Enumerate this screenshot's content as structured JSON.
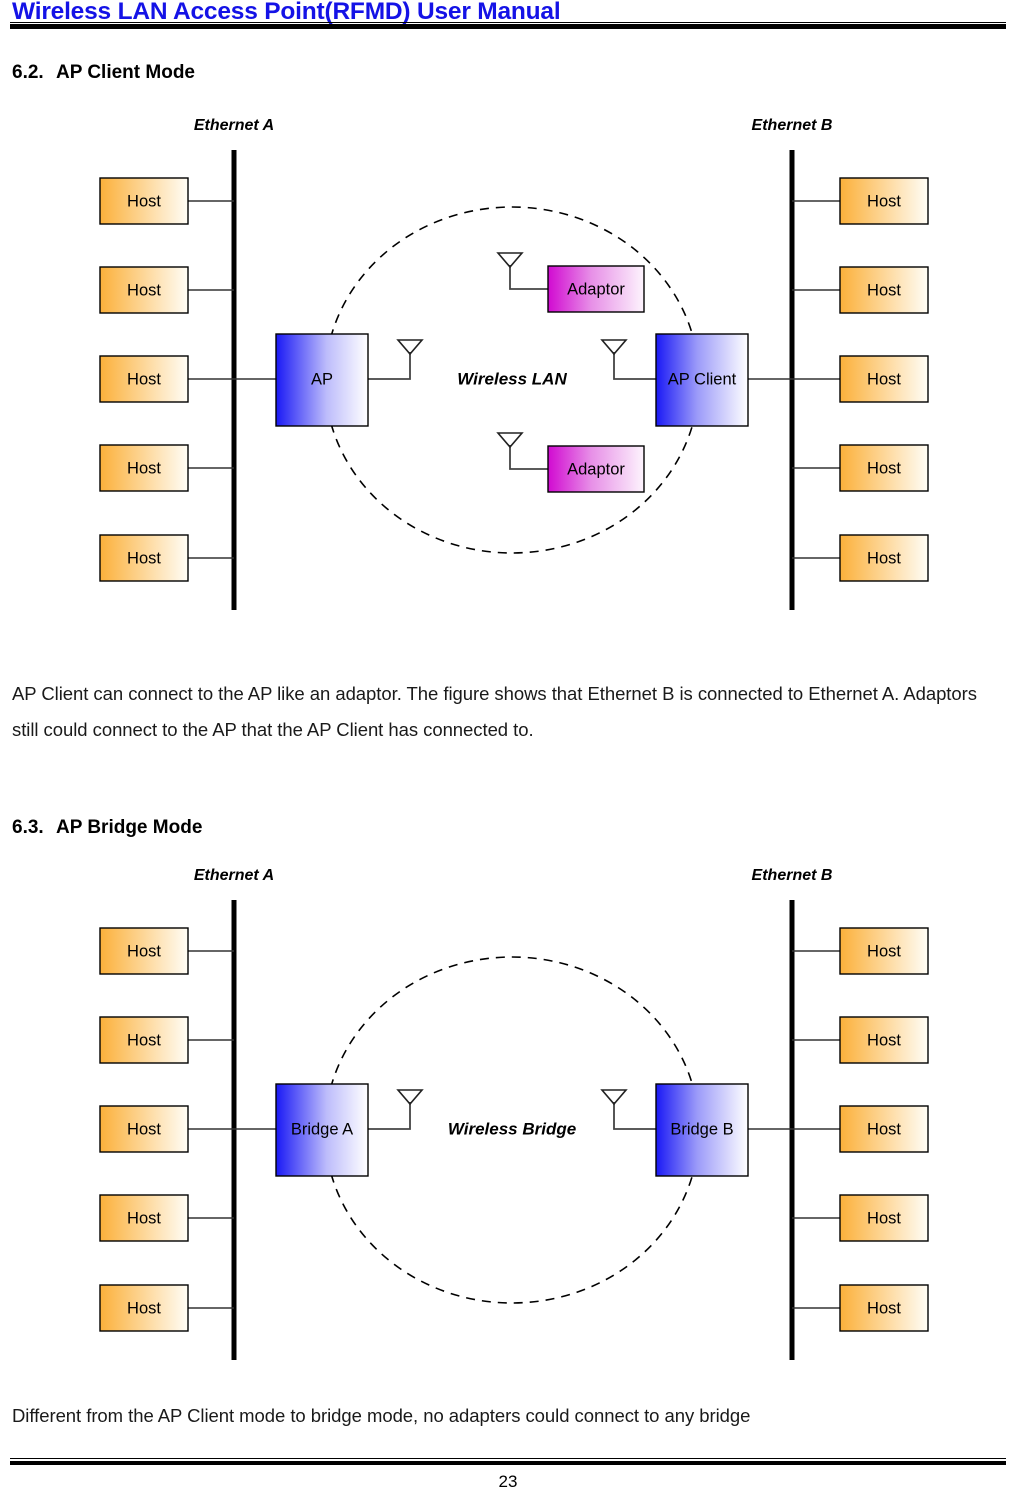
{
  "header": {
    "title": "Wireless LAN Access Point(RFMD) User Manual"
  },
  "footer": {
    "page_number": "23"
  },
  "sections": [
    {
      "number": "6.2.",
      "title": "AP Client Mode",
      "paragraph": "AP Client can connect to the AP like an adaptor. The figure shows that Ethernet B is connected to Ethernet A. Adaptors still could connect to the AP that the AP Client has connected to."
    },
    {
      "number": "6.3.",
      "title": "AP Bridge Mode",
      "paragraph": "Different from the AP Client mode to bridge mode, no adapters could connect to any bridge"
    }
  ],
  "figures": [
    {
      "id": "ap-client-mode-diagram",
      "bus_left_label": "Ethernet A",
      "bus_right_label": "Ethernet B",
      "cloud_label": "Wireless LAN",
      "left_hosts": [
        "Host",
        "Host",
        "Host",
        "Host",
        "Host"
      ],
      "right_hosts": [
        "Host",
        "Host",
        "Host",
        "Host",
        "Host"
      ],
      "left_device_label": "AP",
      "right_device_label": "AP Client",
      "adaptors": [
        "Adaptor",
        "Adaptor"
      ]
    },
    {
      "id": "ap-bridge-mode-diagram",
      "bus_left_label": "Ethernet A",
      "bus_right_label": "Ethernet B",
      "cloud_label": "Wireless Bridge",
      "left_hosts": [
        "Host",
        "Host",
        "Host",
        "Host",
        "Host"
      ],
      "right_hosts": [
        "Host",
        "Host",
        "Host",
        "Host",
        "Host"
      ],
      "left_device_label": "Bridge A",
      "right_device_label": "Bridge B",
      "adaptors": []
    }
  ],
  "colors": {
    "header_title": "#1412e6",
    "host_fill_start": "#fbb03b",
    "host_fill_end": "#fffdf6",
    "device_fill_start": "#1a19f5",
    "device_fill_end": "#ffffff",
    "adaptor_fill_start": "#d10ad1",
    "adaptor_fill_end": "#fdf4fd",
    "bus_line": "#000000",
    "cloud_stroke": "#000000"
  }
}
